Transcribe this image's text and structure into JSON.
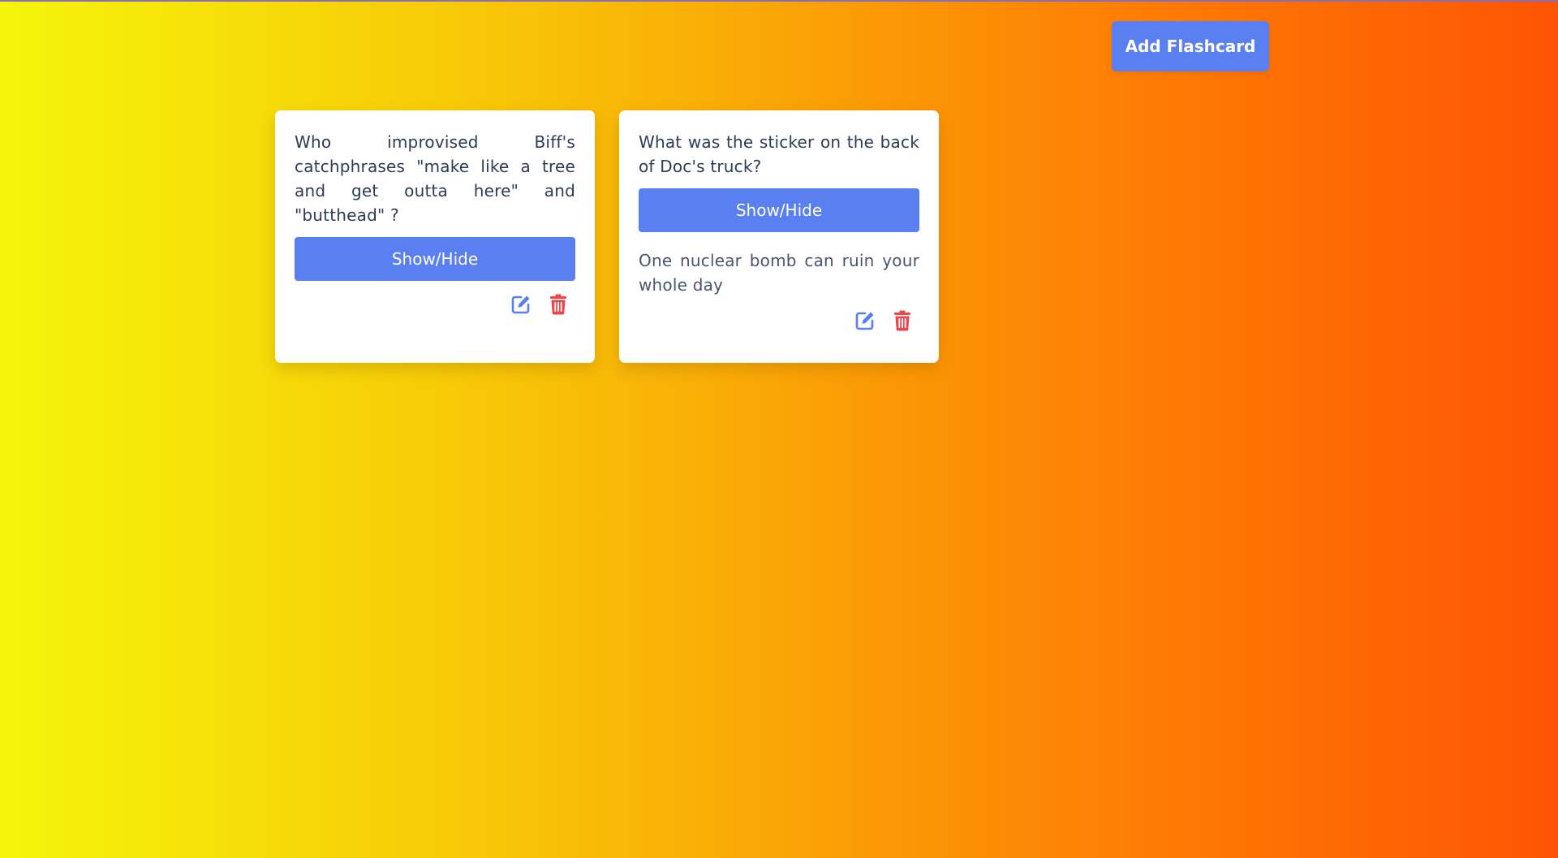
{
  "header": {
    "add_button_label": "Add Flashcard"
  },
  "colors": {
    "accent": "#5a7ff0",
    "delete": "#f0444c",
    "background_start": "#f5f50a",
    "background_end": "#ff5404"
  },
  "flashcards": [
    {
      "question": "Who improvised Biff's catchphrases \"make like a tree and get outta here\" and \"butthead\" ?",
      "toggle_label": "Show/Hide",
      "answer": "",
      "answer_visible": false,
      "edit_icon": "edit-icon",
      "delete_icon": "trash-icon"
    },
    {
      "question": "What was the sticker on the back of Doc's truck?",
      "toggle_label": "Show/Hide",
      "answer": "One nuclear bomb can ruin your whole day",
      "answer_visible": true,
      "edit_icon": "edit-icon",
      "delete_icon": "trash-icon"
    }
  ]
}
